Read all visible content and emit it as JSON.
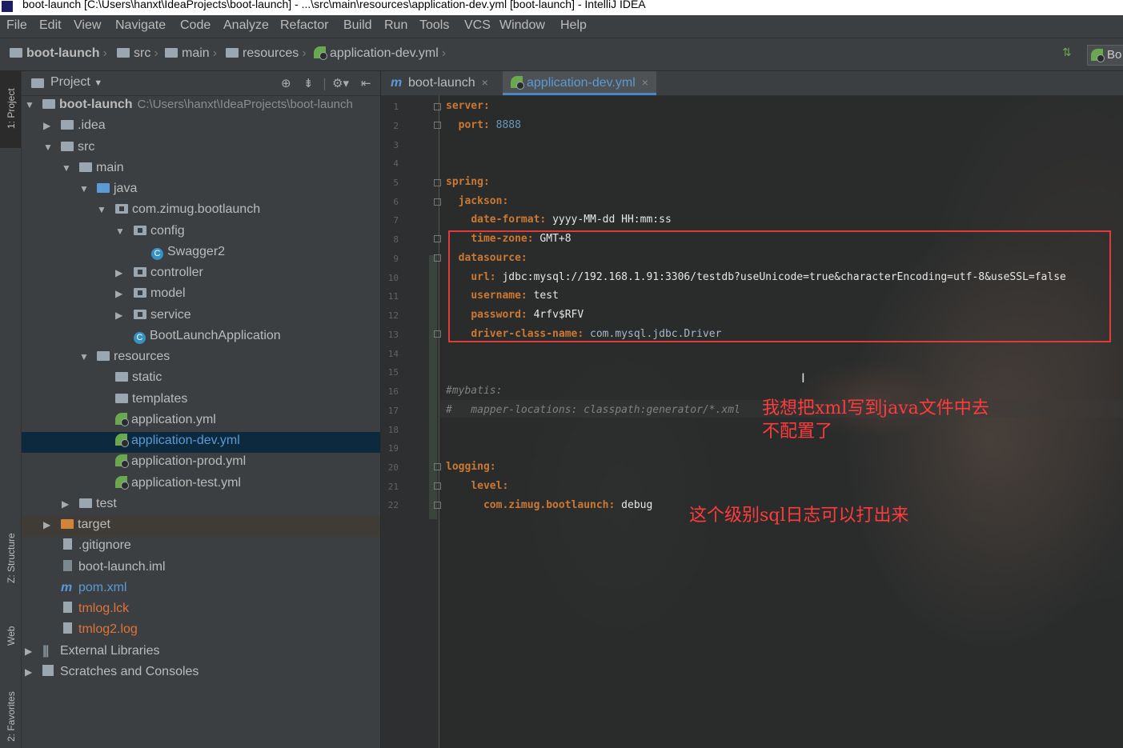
{
  "window": {
    "title": "boot-launch [C:\\Users\\hanxt\\IdeaProjects\\boot-launch] - ...\\src\\main\\resources\\application-dev.yml [boot-launch] - IntelliJ IDEA"
  },
  "menu": [
    "File",
    "Edit",
    "View",
    "Navigate",
    "Code",
    "Analyze",
    "Refactor",
    "Build",
    "Run",
    "Tools",
    "VCS",
    "Window",
    "Help"
  ],
  "breadcrumb": [
    "boot-launch",
    "src",
    "main",
    "resources",
    "application-dev.yml"
  ],
  "nav_right": {
    "run_config": "Bo"
  },
  "left_strip": {
    "project_tab": "1: Project",
    "structure_tab": "Z: Structure",
    "web_tab": "Web",
    "favorites_tab": "2: Favorites"
  },
  "project_panel": {
    "title": "Project",
    "tree": [
      {
        "label": "boot-launch",
        "path": "C:\\Users\\hanxt\\IdeaProjects\\boot-launch"
      },
      {
        "label": ".idea"
      },
      {
        "label": "src"
      },
      {
        "label": "main"
      },
      {
        "label": "java"
      },
      {
        "label": "com.zimug.bootlaunch"
      },
      {
        "label": "config"
      },
      {
        "label": "Swagger2"
      },
      {
        "label": "controller"
      },
      {
        "label": "model"
      },
      {
        "label": "service"
      },
      {
        "label": "BootLaunchApplication"
      },
      {
        "label": "resources"
      },
      {
        "label": "static"
      },
      {
        "label": "templates"
      },
      {
        "label": "application.yml"
      },
      {
        "label": "application-dev.yml"
      },
      {
        "label": "application-prod.yml"
      },
      {
        "label": "application-test.yml"
      },
      {
        "label": "test"
      },
      {
        "label": "target"
      },
      {
        "label": ".gitignore"
      },
      {
        "label": "boot-launch.iml"
      },
      {
        "label": "pom.xml"
      },
      {
        "label": "tmlog.lck"
      },
      {
        "label": "tmlog2.log"
      },
      {
        "label": "External Libraries"
      },
      {
        "label": "Scratches and Consoles"
      }
    ]
  },
  "editor": {
    "tabs": [
      {
        "label": "boot-launch"
      },
      {
        "label": "application-dev.yml"
      }
    ],
    "line_numbers": [
      "1",
      "2",
      "3",
      "4",
      "5",
      "6",
      "7",
      "8",
      "9",
      "10",
      "11",
      "12",
      "13",
      "14",
      "15",
      "16",
      "17",
      "18",
      "19",
      "20",
      "21",
      "22"
    ],
    "code": {
      "l1_key": "server:",
      "l2_key": "port:",
      "l2_val": "8888",
      "l5_key": "spring:",
      "l6_key": "jackson:",
      "l7_key": "date-format:",
      "l7_val": "yyyy-MM-dd HH:mm:ss",
      "l8_key": "time-zone:",
      "l8_val": "GMT+8",
      "l9_key": "datasource:",
      "l10_key": "url:",
      "l10_val": "jdbc:mysql://192.168.1.91:3306/testdb?useUnicode=true&characterEncoding=utf-8&useSSL=false",
      "l11_key": "username:",
      "l11_val": "test",
      "l12_key": "password:",
      "l12_val": "4rfv$RFV",
      "l13_key": "driver-class-name:",
      "l13_val": "com.mysql.jdbc.Driver",
      "l16_comment": "#mybatis:",
      "l17_comment": "#   mapper-locations: classpath:generator/*.xml",
      "l20_key": "logging:",
      "l21_key": "level:",
      "l22_key": "com.zimug.bootlaunch:",
      "l22_val": "debug"
    },
    "annotations": {
      "note1_line1": "我想把xml写到java文件中去",
      "note1_line2": "不配置了",
      "note2": "这个级别sql日志可以打出来"
    },
    "colors": {
      "highlight_box": "#e03a3a",
      "annotation": "#ff3b3b",
      "yaml_key": "#cc7832"
    }
  }
}
